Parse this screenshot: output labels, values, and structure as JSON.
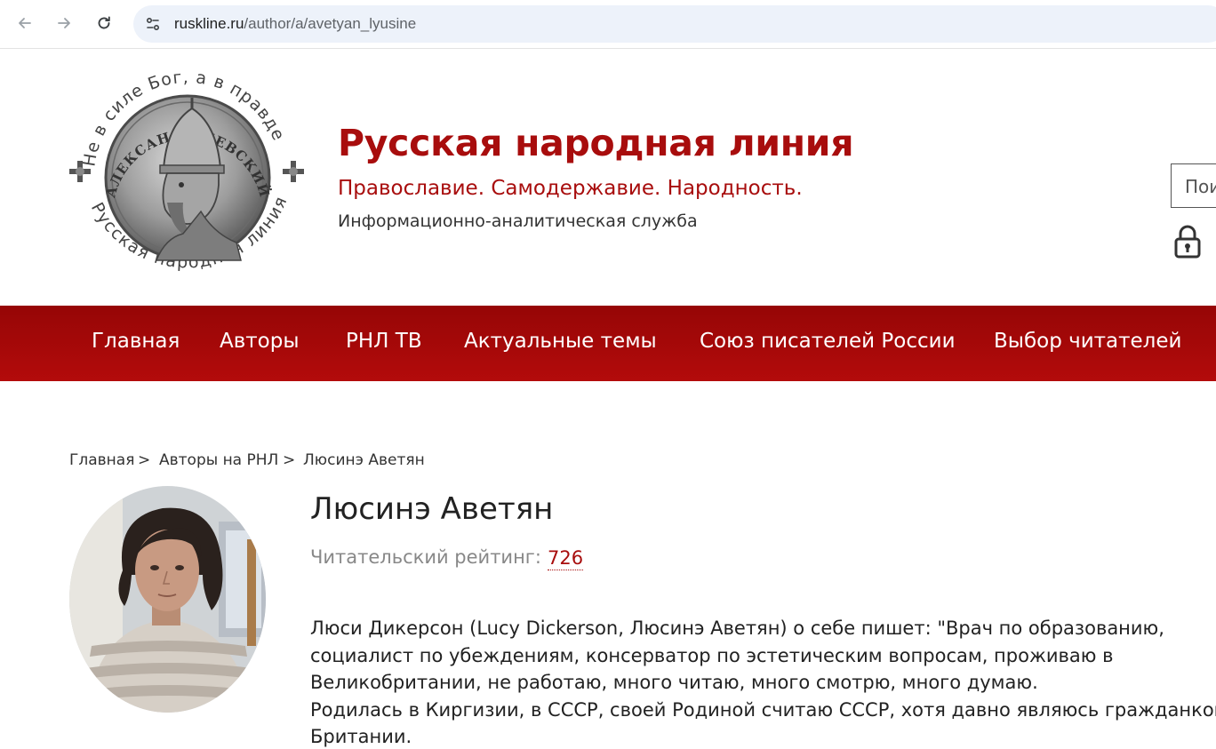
{
  "browser": {
    "url_domain": "ruskline.ru",
    "url_path": "/author/a/avetyan_lyusine",
    "icons": [
      "back-arrow-icon",
      "forward-arrow-icon",
      "reload-icon",
      "site-info-icon"
    ]
  },
  "header": {
    "logo_text_top": "Не в силе Бог, а в правде",
    "logo_text_bottom": "Русская народная линия",
    "logo_text_inner": "АЛЕКСАНДР НЕВСКИЙ",
    "title": "Русская народная линия",
    "motto": "Православие. Самодержавие. Народность.",
    "subtitle": "Информационно-аналитическая служба",
    "search_placeholder": "Пои",
    "lock_icon": "lock-icon"
  },
  "menu": {
    "items": [
      "Главная",
      "Авторы",
      "РНЛ ТВ",
      "Актуальные темы",
      "Союз писателей России",
      "Выбор читателей"
    ]
  },
  "breadcrumb": {
    "items": [
      "Главная",
      "Авторы на РНЛ",
      "Люсинэ Аветян"
    ],
    "separator": ">"
  },
  "author": {
    "name": "Люсинэ Аветян",
    "rating_label": "Читательский рейтинг:",
    "rating_value": "726",
    "bio_lines": [
      "Люси Дикерсон (Lucy Dickerson, Люсинэ Аветян) о себе пишет: \"Врач по образованию,",
      "социалист по убеждениям, консерватор по эстетическим вопросам, проживаю в",
      "Великобритании, не работаю, много читаю, много смотрю, много думаю.",
      "Родилась в Киргизии, в СССР, своей Родиной считаю СССР, хотя давно являюсь гражданкой",
      "Британии."
    ]
  },
  "colors": {
    "brand_red": "#a80d0d",
    "menu_top": "#960606",
    "menu_bottom": "#b30b0b"
  }
}
